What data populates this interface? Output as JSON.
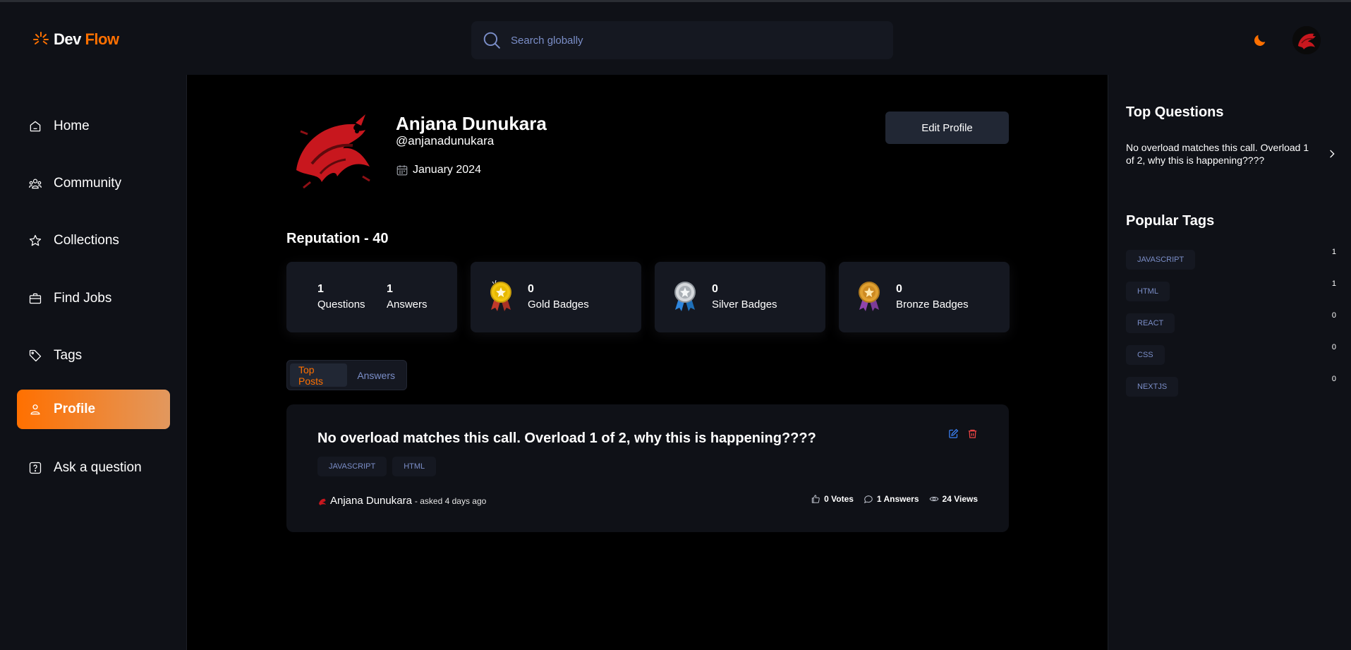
{
  "header": {
    "logo_dev": "Dev",
    "logo_flow": "Flow",
    "search_placeholder": "Search globally"
  },
  "sidebar": {
    "items": [
      {
        "label": "Home",
        "icon": "home-icon"
      },
      {
        "label": "Community",
        "icon": "users-icon"
      },
      {
        "label": "Collections",
        "icon": "star-icon"
      },
      {
        "label": "Find Jobs",
        "icon": "suitcase-icon"
      },
      {
        "label": "Tags",
        "icon": "tag-icon"
      },
      {
        "label": "Profile",
        "icon": "user-icon",
        "active": true
      },
      {
        "label": "Ask a question",
        "icon": "question-icon"
      }
    ]
  },
  "profile": {
    "name": "Anjana Dunukara",
    "username": "@anjanadunukara",
    "joined": "January 2024",
    "edit_label": "Edit Profile",
    "reputation_label": "Reputation - 40"
  },
  "stats": {
    "questions_count": "1",
    "questions_label": "Questions",
    "answers_count": "1",
    "answers_label": "Answers",
    "gold_count": "0",
    "gold_label": "Gold Badges",
    "silver_count": "0",
    "silver_label": "Silver Badges",
    "bronze_count": "0",
    "bronze_label": "Bronze Badges"
  },
  "tabs": {
    "top_posts": "Top Posts",
    "answers": "Answers"
  },
  "post": {
    "title": "No overload matches this call. Overload 1 of 2, why this is happening????",
    "tags": [
      "JAVASCRIPT",
      "HTML"
    ],
    "author": "Anjana Dunukara",
    "asked": "- asked 4 days ago",
    "votes": "0 Votes",
    "answers": "1 Answers",
    "views": "24 Views"
  },
  "right_sidebar": {
    "top_questions_title": "Top Questions",
    "top_questions": [
      "No overload matches this call. Overload 1 of 2, why this is happening????"
    ],
    "popular_tags_title": "Popular Tags",
    "popular_tags": [
      {
        "name": "JAVASCRIPT",
        "count": "1"
      },
      {
        "name": "HTML",
        "count": "1"
      },
      {
        "name": "REACT",
        "count": "0"
      },
      {
        "name": "CSS",
        "count": "0"
      },
      {
        "name": "NEXTJS",
        "count": "0"
      }
    ]
  },
  "colors": {
    "accent": "#ff7000",
    "accent_light": "#e2985e",
    "panel": "#0f1117",
    "card": "#151821",
    "muted_blue": "#7b8ec8"
  }
}
